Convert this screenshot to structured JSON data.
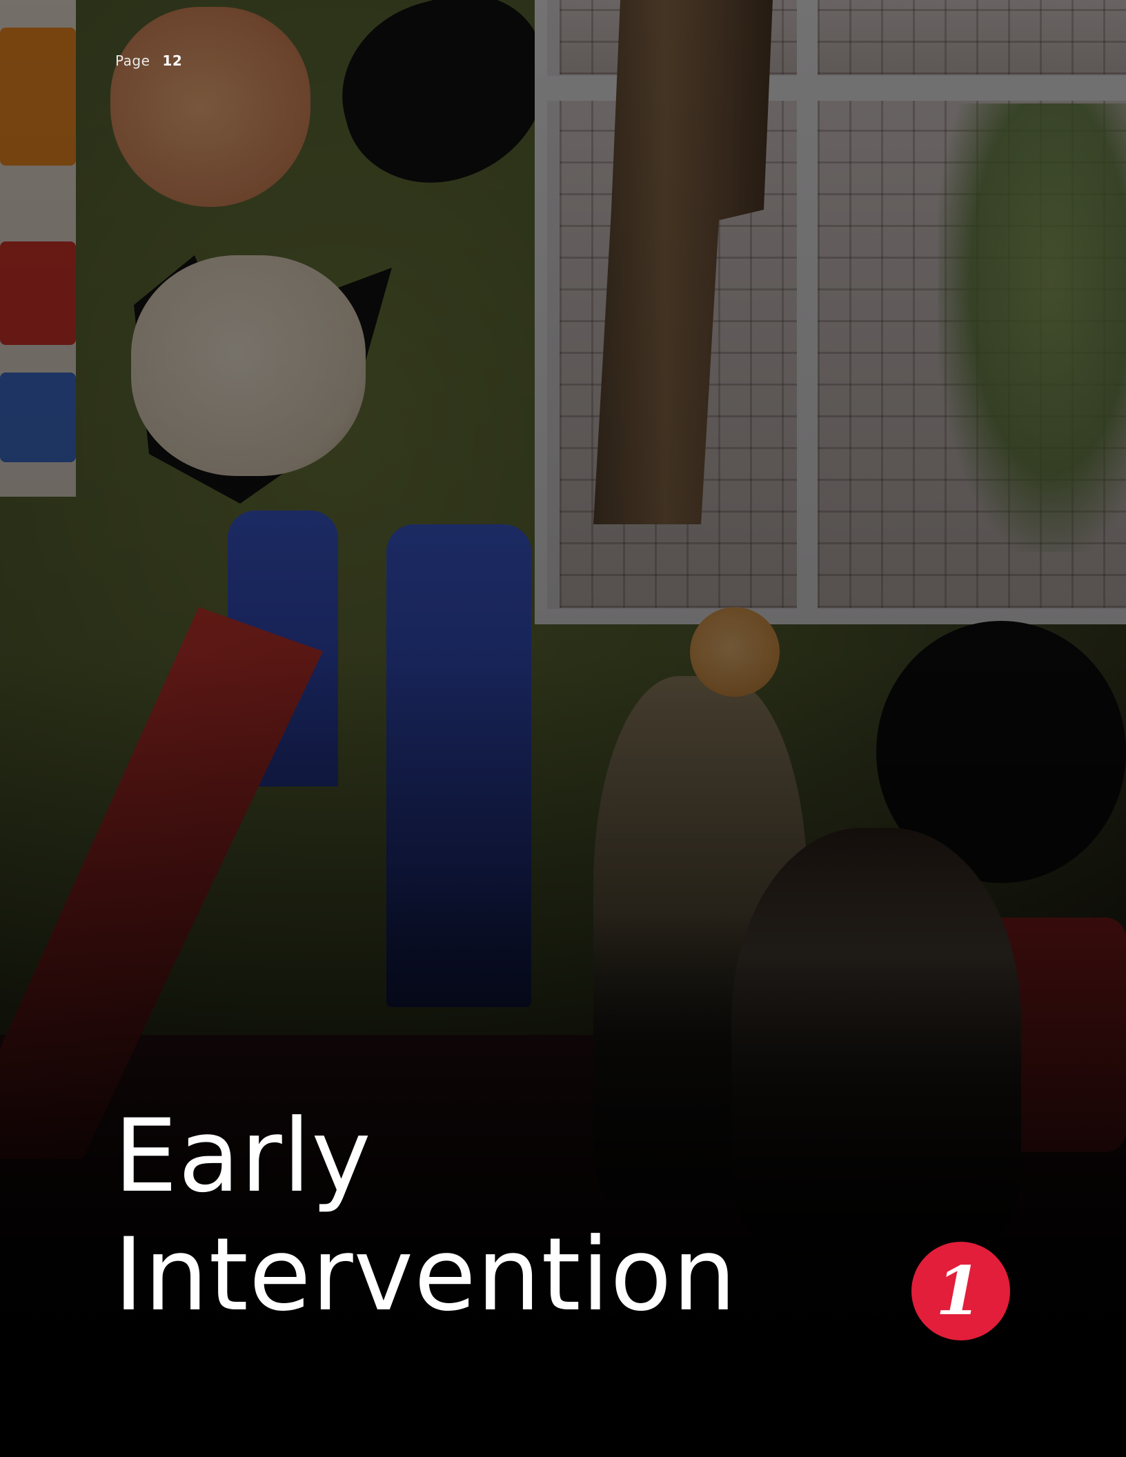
{
  "page": {
    "label": "Page",
    "number": "12"
  },
  "title": {
    "line1": "Early",
    "line2": "Intervention"
  },
  "badge": {
    "number": "1",
    "color": "#e21e3a"
  },
  "background": {
    "description_icon": "classroom-photo"
  }
}
